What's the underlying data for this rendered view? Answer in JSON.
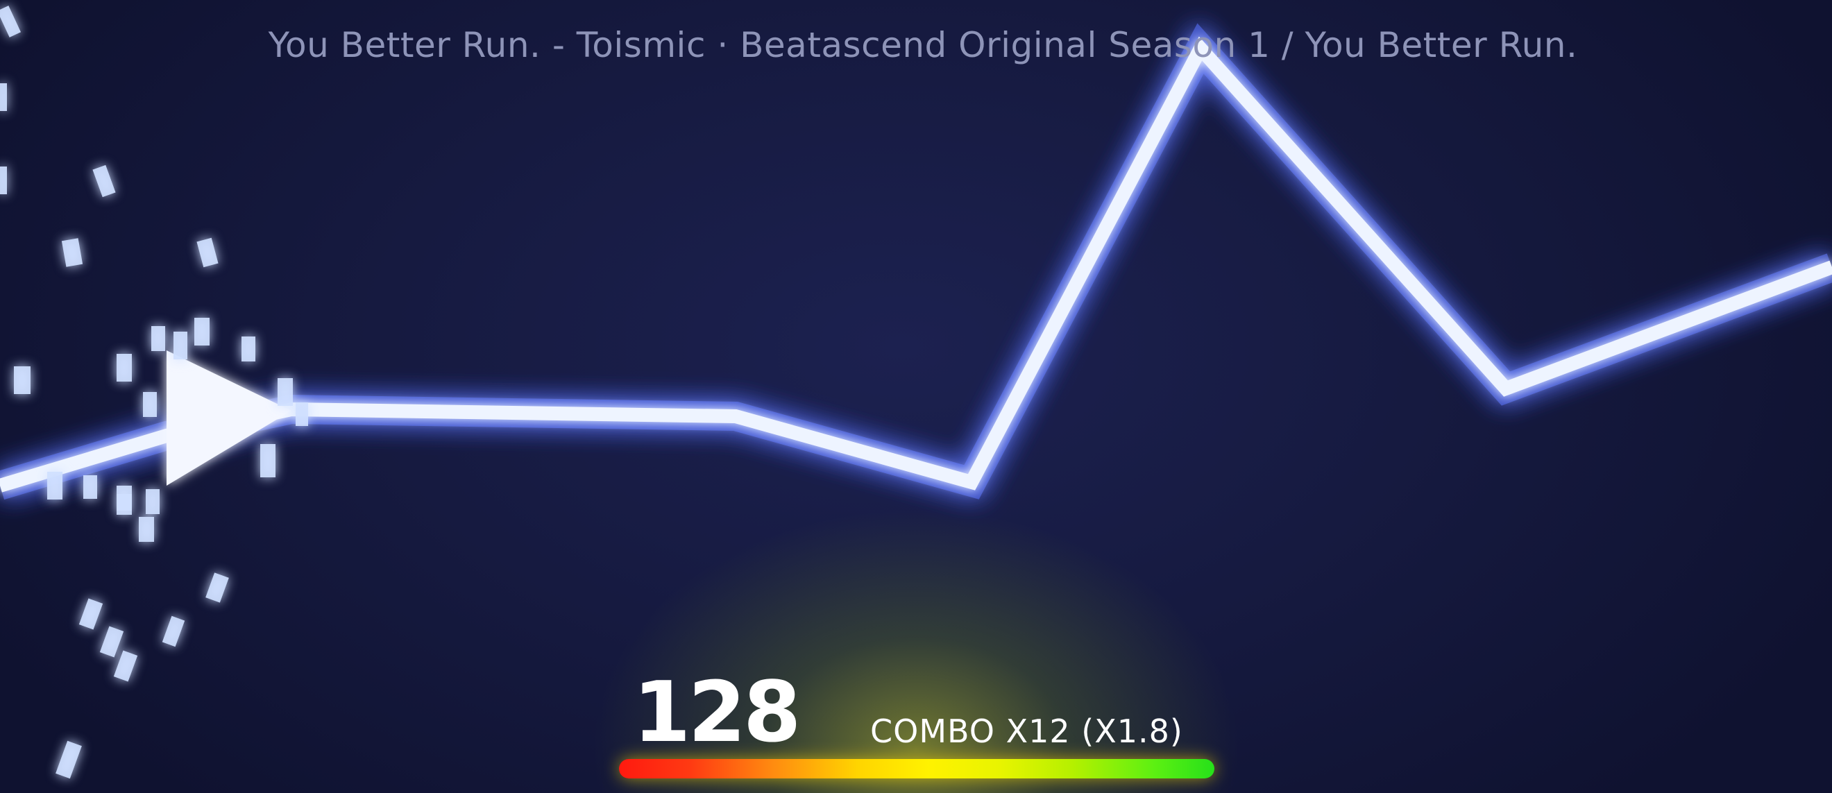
{
  "hud": {
    "song_title": "You Better Run. - Toismic · Beatascend Original Season 1 / You Better Run.",
    "score": "128",
    "combo": "COMBO X12 (X1.8)",
    "meter_gradient": [
      "#ff1a10",
      "#ffd400",
      "#fff200",
      "#5cf012",
      "#26e01a"
    ]
  },
  "scene": {
    "accent_color": "#eaf2ff",
    "glow_color": "#6f86ff",
    "background_color": "#161a40"
  }
}
